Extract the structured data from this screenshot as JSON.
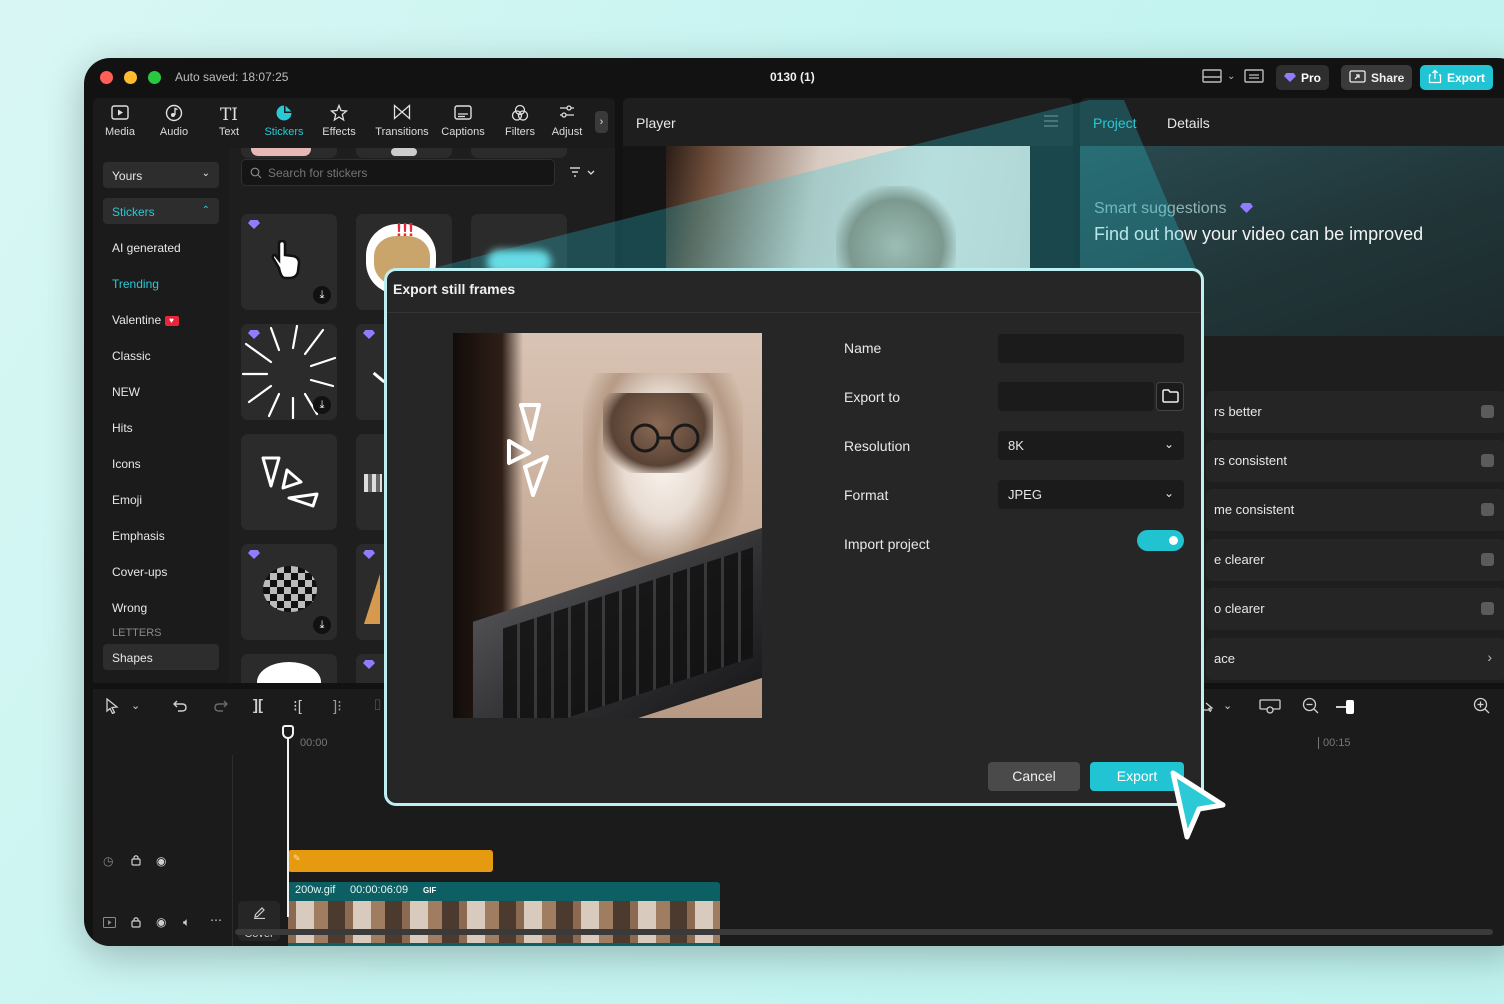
{
  "titlebar": {
    "autosaved": "Auto saved: 18:07:25",
    "project_name": "0130 (1)",
    "pro_label": "Pro",
    "share_label": "Share",
    "export_label": "Export"
  },
  "toolbar": {
    "items": [
      {
        "label": "Media",
        "icon": "media-icon"
      },
      {
        "label": "Audio",
        "icon": "audio-icon"
      },
      {
        "label": "Text",
        "icon": "text-icon"
      },
      {
        "label": "Stickers",
        "icon": "stickers-icon",
        "active": true
      },
      {
        "label": "Effects",
        "icon": "effects-icon"
      },
      {
        "label": "Transitions",
        "icon": "transitions-icon"
      },
      {
        "label": "Captions",
        "icon": "captions-icon"
      },
      {
        "label": "Filters",
        "icon": "filters-icon"
      },
      {
        "label": "Adjust",
        "icon": "adjust-icon"
      }
    ]
  },
  "stickers_panel": {
    "search_placeholder": "Search for stickers",
    "categories": [
      {
        "label": "Yours"
      },
      {
        "label": "Stickers"
      },
      {
        "label": "AI generated"
      },
      {
        "label": "Trending"
      },
      {
        "label": "Valentine"
      },
      {
        "label": "Classic"
      },
      {
        "label": "NEW"
      },
      {
        "label": "Hits"
      },
      {
        "label": "Icons"
      },
      {
        "label": "Emoji"
      },
      {
        "label": "Emphasis"
      },
      {
        "label": "Cover-ups"
      },
      {
        "label": "Wrong"
      },
      {
        "label": "LETTERS"
      },
      {
        "label": "Shapes"
      }
    ]
  },
  "player": {
    "title": "Player"
  },
  "right_panel": {
    "tabs": [
      "Project",
      "Details"
    ],
    "smart_title": "Smart suggestions",
    "smart_heading": "Find out how your video can be improved",
    "rows": [
      "rs better",
      "rs consistent",
      "me consistent",
      "e clearer",
      "o clearer",
      "ace"
    ]
  },
  "timeline": {
    "time_start": "00:00",
    "time_mark": "00:15",
    "clip_name": "200w.gif",
    "clip_duration": "00:00:06:09",
    "clip_badge": "GIF",
    "cover_label": "Cover"
  },
  "dialog": {
    "title": "Export still frames",
    "name_label": "Name",
    "name_value": "",
    "export_to_label": "Export to",
    "export_to_value": "",
    "resolution_label": "Resolution",
    "resolution_value": "8K",
    "format_label": "Format",
    "format_value": "JPEG",
    "import_label": "Import project",
    "import_enabled": true,
    "cancel_label": "Cancel",
    "export_label": "Export"
  },
  "colors": {
    "accent": "#29c9d6",
    "background": "#121212",
    "panel": "#1e1e1e"
  }
}
